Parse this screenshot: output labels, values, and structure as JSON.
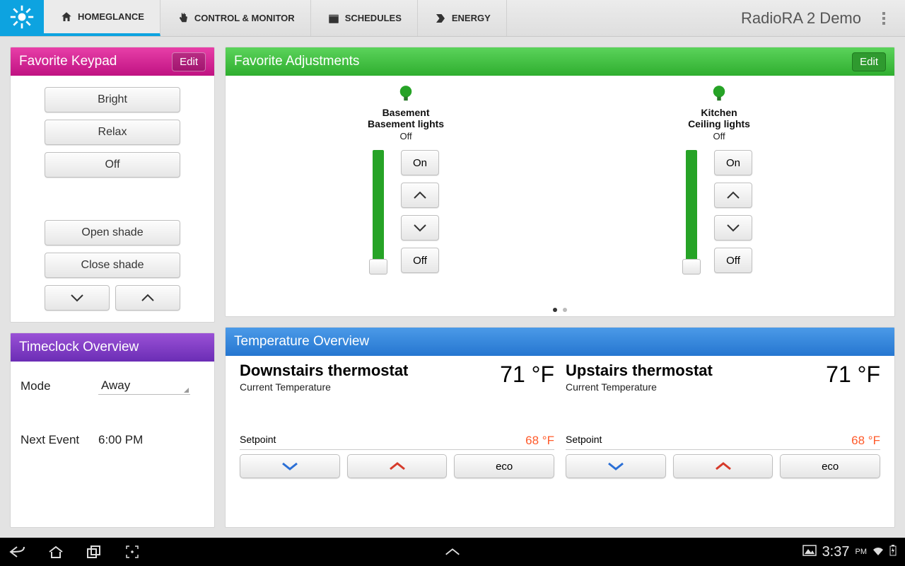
{
  "app_title": "RadioRA 2 Demo",
  "tabs": {
    "homeglance": "HOMEGLANCE",
    "control": "CONTROL & MONITOR",
    "schedules": "SCHEDULES",
    "energy": "ENERGY"
  },
  "keypad": {
    "title": "Favorite Keypad",
    "edit": "Edit",
    "buttons": [
      "Bright",
      "Relax",
      "Off"
    ],
    "shade_buttons": [
      "Open shade",
      "Close shade"
    ]
  },
  "timeclock": {
    "title": "Timeclock Overview",
    "mode_label": "Mode",
    "mode_value": "Away",
    "next_label": "Next Event",
    "next_value": "6:00 PM"
  },
  "adjustments": {
    "title": "Favorite Adjustments",
    "edit": "Edit",
    "items": [
      {
        "room": "Basement",
        "device": "Basement lights",
        "state": "Off",
        "on": "On",
        "off": "Off"
      },
      {
        "room": "Kitchen",
        "device": "Ceiling lights",
        "state": "Off",
        "on": "On",
        "off": "Off"
      }
    ]
  },
  "temperature": {
    "title": "Temperature Overview",
    "thermos": [
      {
        "name": "Downstairs thermostat",
        "sub": "Current Temperature",
        "temp": "71 °F",
        "sp_label": "Setpoint",
        "sp_val": "68 °F",
        "eco": "eco"
      },
      {
        "name": "Upstairs thermostat",
        "sub": "Current Temperature",
        "temp": "71 °F",
        "sp_label": "Setpoint",
        "sp_val": "68 °F",
        "eco": "eco"
      }
    ]
  },
  "statusbar": {
    "time": "3:37",
    "ampm": "PM"
  }
}
